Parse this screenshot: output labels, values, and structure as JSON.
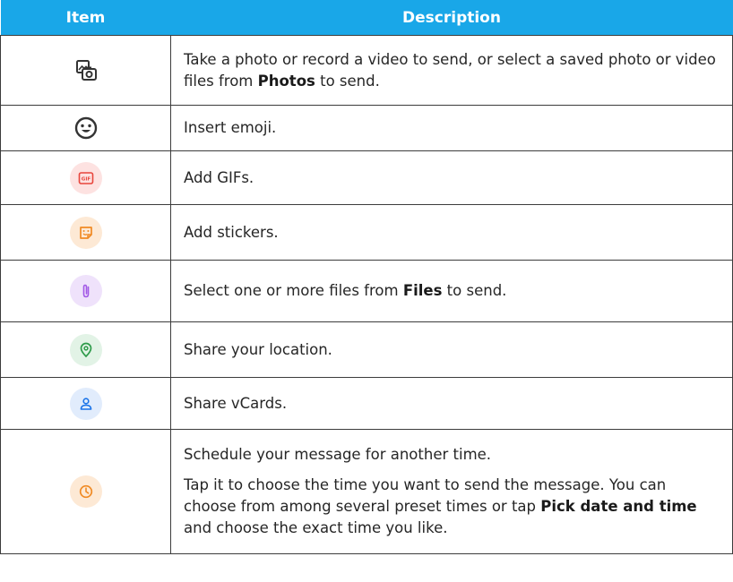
{
  "table": {
    "headers": {
      "item": "Item",
      "description": "Description"
    },
    "rows": [
      {
        "icon": "photo-camera-icon",
        "desc_pre": "Take a photo or record a video to send, or select a saved photo or video files from ",
        "desc_bold": "Photos",
        "desc_post": " to send."
      },
      {
        "icon": "emoji-icon",
        "desc": "Insert emoji."
      },
      {
        "icon": "gif-icon",
        "icon_label": "GIF",
        "desc": "Add GIFs."
      },
      {
        "icon": "sticker-icon",
        "desc": "Add stickers."
      },
      {
        "icon": "attachment-icon",
        "desc_pre": "Select one or more files from ",
        "desc_bold": "Files",
        "desc_post": " to send."
      },
      {
        "icon": "location-pin-icon",
        "desc": "Share your location."
      },
      {
        "icon": "contact-person-icon",
        "desc": "Share vCards."
      },
      {
        "icon": "clock-icon",
        "desc_p1": "Schedule your message for another time.",
        "desc_p2_pre": "Tap it to choose the time you want to send the message. You can choose from among several preset times or tap ",
        "desc_p2_bold": "Pick date and time",
        "desc_p2_post": " and choose the exact time you like."
      }
    ]
  },
  "colors": {
    "header_bg": "#19a7e8",
    "gif_bg": "#fde2e1",
    "gif_fg": "#e8453c",
    "sticker_bg": "#fde9d5",
    "sticker_fg": "#f08a24",
    "attach_bg": "#efe2fb",
    "attach_fg": "#a259e6",
    "location_bg": "#e2f3e6",
    "location_fg": "#2e9b4a",
    "contact_bg": "#e1ecfc",
    "contact_fg": "#1a73e8",
    "clock_bg": "#fde9d5",
    "clock_fg": "#f08a24"
  }
}
